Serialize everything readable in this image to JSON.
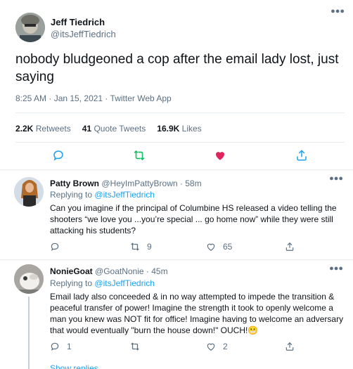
{
  "main_tweet": {
    "author_name": "Jeff Tiedrich",
    "author_handle": "@itsJeffTiedrich",
    "text": "nobody bludgeoned a cop after the email lady lost, just saying",
    "meta": "8:25 AM · Jan 15, 2021 · Twitter Web App",
    "stats": {
      "retweets_count": "2.2K",
      "retweets_label": "Retweets",
      "quotes_count": "41",
      "quotes_label": "Quote Tweets",
      "likes_count": "16.9K",
      "likes_label": "Likes"
    },
    "actions": [
      "reply-icon",
      "retweet-icon",
      "like-icon",
      "share-icon"
    ],
    "colors": {
      "retweet": "#17bf63",
      "like": "#e0245e"
    }
  },
  "replies": [
    {
      "author_name": "Patty Brown",
      "author_handle": "@HeyImPattyBrown",
      "time": "· 58m",
      "replying_prefix": "Replying to",
      "replying_to": "@itsJeffTiedrich",
      "text": "Can you imagine if the principal of Columbine HS released a video telling the shooters “we love you ...you’re special ... go home now” while they were still attacking his students?",
      "reply_count": "",
      "retweet_count": "9",
      "like_count": "65"
    },
    {
      "author_name": "NonieGoat",
      "author_handle": "@GoatNonie",
      "time": "· 45m",
      "replying_prefix": "Replying to",
      "replying_to": "@itsJeffTiedrich",
      "text": "Email lady also conceeded & in no way attempted to impede the transition & peaceful transfer of power! Imagine the strength it took to openly welcome a man you knew was NOT fit for office! Imagine having to welcome an adversary that would eventually \"burn the house down!\" OUCH!😬",
      "reply_count": "1",
      "retweet_count": "",
      "like_count": "2"
    }
  ],
  "show_more": "Show replies",
  "link_color": "#1da1f2"
}
